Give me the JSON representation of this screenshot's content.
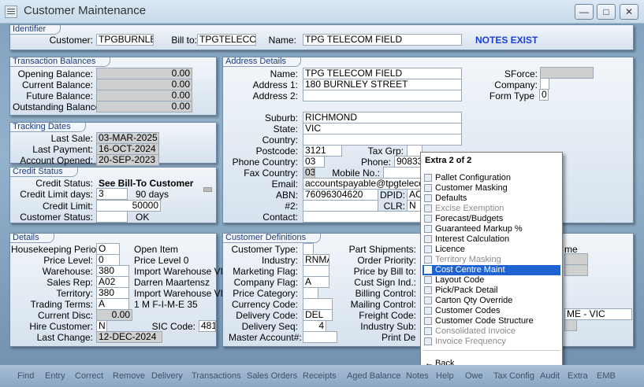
{
  "window": {
    "title": "Customer Maintenance"
  },
  "identifier": {
    "legend": "Identifier",
    "customer_label": "Customer:",
    "customer": "TPGBURNLEY",
    "billto_label": "Bill to:",
    "billto": "TPGTELECOM",
    "name_label": "Name:",
    "name": "TPG TELECOM FIELD",
    "notes": "NOTES EXIST"
  },
  "balances": {
    "legend": "Transaction Balances",
    "rows": [
      {
        "label": "Opening Balance:",
        "value": "0.00"
      },
      {
        "label": "Current Balance:",
        "value": "0.00"
      },
      {
        "label": "Future Balance:",
        "value": "0.00"
      },
      {
        "label": "Outstanding Balance:",
        "value": "0.00"
      }
    ]
  },
  "tracking": {
    "legend": "Tracking Dates",
    "rows": [
      {
        "label": "Last Sale:",
        "value": "03-MAR-2025"
      },
      {
        "label": "Last Payment:",
        "value": "16-OCT-2024"
      },
      {
        "label": "Account Opened:",
        "value": "20-SEP-2023"
      }
    ]
  },
  "credit": {
    "legend": "Credit Status",
    "status_label": "Credit Status:",
    "status": "See Bill-To Customer",
    "days_label": "Credit Limit days:",
    "days": "3",
    "days_desc": "90 days",
    "limit_label": "Credit Limit:",
    "limit": "50000",
    "cust_status_label": "Customer Status:",
    "cust_status_desc": "OK"
  },
  "address": {
    "legend": "Address Details",
    "name_label": "Name:",
    "name": "TPG TELECOM FIELD",
    "addr1_label": "Address 1:",
    "addr1": "180 BURNLEY STREET",
    "addr2_label": "Address 2:",
    "addr2": "",
    "suburb_label": "Suburb:",
    "suburb": "RICHMOND",
    "state_label": "State:",
    "state": "VIC",
    "country_label": "Country:",
    "country": "",
    "postcode_label": "Postcode:",
    "postcode": "3121",
    "taxgrp_label": "Tax Grp:",
    "phone_country_label": "Phone Country:",
    "phone_country": "03",
    "phone_label": "Phone:",
    "phone": "90833190",
    "fax_country_label": "Fax Country:",
    "fax_country": "03",
    "mobile_label": "Mobile No.:",
    "email_label": "Email:",
    "email": "accountspayable@tpgtelecom.com",
    "abn_label": "ABN:",
    "abn": "76096304620",
    "dpid_label": "DPID:",
    "dpid": "AC",
    "num2_label": "#2:",
    "clr_label": "CLR:",
    "clr": "N",
    "contact_label": "Contact:",
    "sforce_label": "SForce:",
    "company_label": "Company:",
    "formtype_label": "Form Type",
    "formtype": "0"
  },
  "details": {
    "legend": "Details",
    "hk_label": "Housekeeping Period:",
    "hk": "O",
    "hk_desc": "Open Item",
    "pl_label": "Price Level:",
    "pl": "0",
    "pl_desc": "Price Level 0",
    "wh_label": "Warehouse:",
    "wh": "380",
    "wh_desc": "Import Warehouse VI(",
    "rep_label": "Sales Rep:",
    "rep": "A02",
    "rep_desc": "Darren Maartensz",
    "terr_label": "Territory:",
    "terr": "380",
    "terr_desc": "Import Warehouse VI(",
    "tt_label": "Trading Terms:",
    "tt": "A",
    "tt_desc": "1 M F-I-M-E 35",
    "disc_label": "Current Disc:",
    "disc": "0.00",
    "hire_label": "Hire Customer:",
    "hire": "N",
    "sic_label": "SIC Code:",
    "sic": "4813",
    "lc_label": "Last Change:",
    "lc": "12-DEC-2024"
  },
  "custdef": {
    "legend": "Customer Definitions",
    "ctype_label": "Customer Type:",
    "ind_label": "Industry:",
    "ind": "RNMA",
    "mkt_label": "Marketing Flag:",
    "cf_label": "Company Flag:",
    "cf": "A",
    "pc_label": "Price Category:",
    "cc_label": "Currency Code:",
    "dc_label": "Delivery Code:",
    "dc": "DEL",
    "ds_label": "Delivery Seq:",
    "ds": "4",
    "ma_label": "Master Account#:",
    "ps_label": "Part Shipments:",
    "op_label": "Order Priority:",
    "pbb_label": "Price by Bill to:",
    "csi_label": "Cust Sign Ind.:",
    "bc_label": "Billing Control:",
    "mc_label": "Mailing Control:",
    "fc_label": "Freight Code:",
    "isub_label": "Industry Sub:",
    "pd_label": "Print De",
    "frag_me": "me",
    "frag_vic": "ME - VIC"
  },
  "menu": {
    "header": "Extra 2 of 2",
    "items": [
      {
        "label": "Pallet Configuration",
        "disabled": false
      },
      {
        "label": "Customer Masking",
        "disabled": false
      },
      {
        "label": "Defaults",
        "disabled": false
      },
      {
        "label": "Excise Exemption",
        "disabled": true
      },
      {
        "label": "Forecast/Budgets",
        "disabled": false
      },
      {
        "label": "Guaranteed Markup %",
        "disabled": false
      },
      {
        "label": "Interest Calculation",
        "disabled": false
      },
      {
        "label": "Licence",
        "disabled": false
      },
      {
        "label": "Territory Masking",
        "disabled": true
      },
      {
        "label": "Cost Centre Maint",
        "disabled": false,
        "selected": true
      },
      {
        "label": "Layout Code",
        "disabled": false
      },
      {
        "label": "Pick/Pack Detail",
        "disabled": false
      },
      {
        "label": "Carton Qty Override",
        "disabled": false
      },
      {
        "label": "Customer Codes",
        "disabled": false
      },
      {
        "label": "Customer Code Structure",
        "disabled": false
      },
      {
        "label": "Consolidated Invoice",
        "disabled": true
      },
      {
        "label": "Invoice Frequency",
        "disabled": true
      }
    ],
    "back": "Back"
  },
  "toolbar": [
    "Find",
    "Entry",
    "Correct",
    "Remove",
    "Delivery",
    "Transactions",
    "Sales Orders",
    "Receipts",
    "Aged Balance",
    "Notes",
    "Help",
    "Owe",
    "Tax Config",
    "Audit",
    "Extra",
    "EMB"
  ],
  "colors": {
    "notes": "#1a3fd8",
    "selected": "#1f63d2"
  }
}
